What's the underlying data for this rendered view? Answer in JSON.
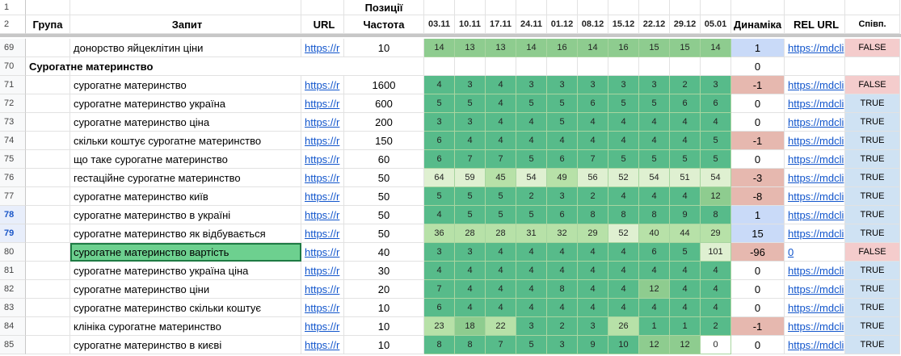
{
  "colors": {
    "pos_top": "#57bb8a",
    "pos_good": "#8ecc8f",
    "pos_mid": "#b7e1a8",
    "pos_light": "#dff0d1",
    "dyn_positive": "#c9daf8",
    "dyn_negative": "#e6b8af",
    "false_fill": "#f4cccc",
    "true_fill": "#cfe2f3",
    "url_color": "#1155cc",
    "selected_row_header": "#e8eefb",
    "selected_cell_fill": "#6dd08f"
  },
  "header": {
    "row1": {
      "num": "1",
      "positions_label": "Позиції"
    },
    "row2": {
      "num": "2",
      "group": "Група",
      "query": "Запит",
      "url": "URL",
      "frequency": "Частота",
      "weeks": [
        "03.11",
        "10.11",
        "17.11",
        "24.11",
        "01.12",
        "08.12",
        "15.12",
        "22.12",
        "29.12",
        "05.01"
      ],
      "dynamics": "Динаміка",
      "rel_url": "REL URL",
      "match": "Співп."
    }
  },
  "rows": [
    {
      "num": "69",
      "query": "донорство яйцеклітин ціни",
      "url": "https://r",
      "freq": "10",
      "pos": [
        "14",
        "13",
        "13",
        "14",
        "16",
        "14",
        "16",
        "15",
        "15",
        "14"
      ],
      "dyn": "1",
      "dyn_state": "pos",
      "rel": "https://mdcli",
      "match": "FALSE"
    },
    {
      "num": "70",
      "group_title": "Сурогатне материнство",
      "dyn": "0",
      "dyn_state": "none"
    },
    {
      "num": "71",
      "query": "сурогатне материнство",
      "url": "https://r",
      "freq": "1600",
      "pos": [
        "4",
        "3",
        "4",
        "3",
        "3",
        "3",
        "3",
        "3",
        "2",
        "3"
      ],
      "dyn": "-1",
      "dyn_state": "neg",
      "rel": "https://mdcli",
      "match": "FALSE"
    },
    {
      "num": "72",
      "query": "сурогатне материнство україна",
      "url": "https://r",
      "freq": "600",
      "pos": [
        "5",
        "5",
        "4",
        "5",
        "5",
        "6",
        "5",
        "5",
        "6",
        "6"
      ],
      "dyn": "0",
      "dyn_state": "none",
      "rel": "https://mdcli",
      "match": "TRUE"
    },
    {
      "num": "73",
      "query": "сурогатне материнство ціна",
      "url": "https://r",
      "freq": "200",
      "pos": [
        "3",
        "3",
        "4",
        "4",
        "5",
        "4",
        "4",
        "4",
        "4",
        "4"
      ],
      "dyn": "0",
      "dyn_state": "none",
      "rel": "https://mdcli",
      "match": "TRUE"
    },
    {
      "num": "74",
      "query": "скільки коштує сурогатне материнство",
      "url": "https://r",
      "freq": "150",
      "pos": [
        "6",
        "4",
        "4",
        "4",
        "4",
        "4",
        "4",
        "4",
        "4",
        "5"
      ],
      "dyn": "-1",
      "dyn_state": "neg",
      "rel": "https://mdcli",
      "match": "TRUE"
    },
    {
      "num": "75",
      "query": "що таке сурогатне материнство",
      "url": "https://r",
      "freq": "60",
      "pos": [
        "6",
        "7",
        "7",
        "5",
        "6",
        "7",
        "5",
        "5",
        "5",
        "5"
      ],
      "dyn": "0",
      "dyn_state": "none",
      "rel": "https://mdcli",
      "match": "TRUE"
    },
    {
      "num": "76",
      "query": "гестаційне сурогатне материнство",
      "url": "https://r",
      "freq": "50",
      "pos": [
        "64",
        "59",
        "45",
        "54",
        "49",
        "56",
        "52",
        "54",
        "51",
        "54"
      ],
      "dyn": "-3",
      "dyn_state": "neg",
      "rel": "https://mdcli",
      "match": "TRUE"
    },
    {
      "num": "77",
      "query": "сурогатне материнство київ",
      "url": "https://r",
      "freq": "50",
      "pos": [
        "5",
        "5",
        "5",
        "2",
        "3",
        "2",
        "4",
        "4",
        "4",
        "12"
      ],
      "dyn": "-8",
      "dyn_state": "neg",
      "rel": "https://mdcli",
      "match": "TRUE"
    },
    {
      "num": "78",
      "query": "сурогатне материнство в україні",
      "url": "https://r",
      "freq": "50",
      "pos": [
        "4",
        "5",
        "5",
        "5",
        "6",
        "8",
        "8",
        "8",
        "9",
        "8"
      ],
      "dyn": "1",
      "dyn_state": "pos",
      "rel": "https://mdcli",
      "match": "TRUE",
      "selected": true
    },
    {
      "num": "79",
      "query": "сурогатне материнство як відбувається",
      "url": "https://r",
      "freq": "50",
      "pos": [
        "36",
        "28",
        "28",
        "31",
        "32",
        "29",
        "52",
        "40",
        "44",
        "29"
      ],
      "dyn": "15",
      "dyn_state": "pos",
      "rel": "https://mdcli",
      "match": "TRUE",
      "selected": true
    },
    {
      "num": "80",
      "query": "сурогатне материнство вартість",
      "url": "https://r",
      "freq": "40",
      "pos": [
        "3",
        "3",
        "4",
        "4",
        "4",
        "4",
        "4",
        "6",
        "5",
        "101"
      ],
      "dyn": "-96",
      "dyn_state": "neg",
      "rel": "0",
      "match": "FALSE",
      "active": true
    },
    {
      "num": "81",
      "query": "сурогатне материнство україна ціна",
      "url": "https://r",
      "freq": "30",
      "pos": [
        "4",
        "4",
        "4",
        "4",
        "4",
        "4",
        "4",
        "4",
        "4",
        "4"
      ],
      "dyn": "0",
      "dyn_state": "none",
      "rel": "https://mdcli",
      "match": "TRUE"
    },
    {
      "num": "82",
      "query": "сурогатне материнство ціни",
      "url": "https://r",
      "freq": "20",
      "pos": [
        "7",
        "4",
        "4",
        "4",
        "8",
        "4",
        "4",
        "12",
        "4",
        "4"
      ],
      "dyn": "0",
      "dyn_state": "none",
      "rel": "https://mdcli",
      "match": "TRUE"
    },
    {
      "num": "83",
      "query": "сурогатне материнство скільки коштує",
      "url": "https://r",
      "freq": "10",
      "pos": [
        "6",
        "4",
        "4",
        "4",
        "4",
        "4",
        "4",
        "4",
        "4",
        "4"
      ],
      "dyn": "0",
      "dyn_state": "none",
      "rel": "https://mdcli",
      "match": "TRUE"
    },
    {
      "num": "84",
      "query": "клініка сурогатне материнство",
      "url": "https://r",
      "freq": "10",
      "pos": [
        "23",
        "18",
        "22",
        "3",
        "2",
        "3",
        "26",
        "1",
        "1",
        "2"
      ],
      "dyn": "-1",
      "dyn_state": "neg",
      "rel": "https://mdcli",
      "match": "TRUE"
    },
    {
      "num": "85",
      "query": "сурогатне материнство в києві",
      "url": "https://r",
      "freq": "10",
      "pos": [
        "8",
        "8",
        "7",
        "5",
        "3",
        "9",
        "10",
        "12",
        "12",
        "0"
      ],
      "dyn": "0",
      "dyn_state": "none",
      "rel": "https://mdcli",
      "match": "TRUE"
    }
  ]
}
